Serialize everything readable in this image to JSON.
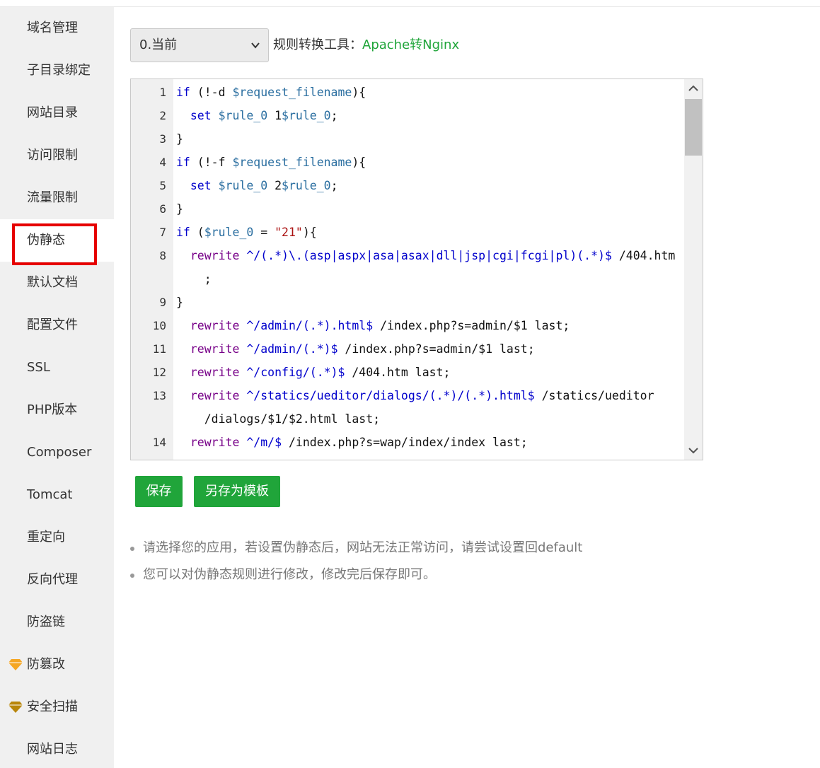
{
  "sidebar": {
    "items": [
      {
        "label": "域名管理",
        "gem": false,
        "active": false
      },
      {
        "label": "子目录绑定",
        "gem": false,
        "active": false
      },
      {
        "label": "网站目录",
        "gem": false,
        "active": false
      },
      {
        "label": "访问限制",
        "gem": false,
        "active": false
      },
      {
        "label": "流量限制",
        "gem": false,
        "active": false
      },
      {
        "label": "伪静态",
        "gem": false,
        "active": true
      },
      {
        "label": "默认文档",
        "gem": false,
        "active": false
      },
      {
        "label": "配置文件",
        "gem": false,
        "active": false
      },
      {
        "label": "SSL",
        "gem": false,
        "active": false
      },
      {
        "label": "PHP版本",
        "gem": false,
        "active": false
      },
      {
        "label": "Composer",
        "gem": false,
        "active": false
      },
      {
        "label": "Tomcat",
        "gem": false,
        "active": false
      },
      {
        "label": "重定向",
        "gem": false,
        "active": false
      },
      {
        "label": "反向代理",
        "gem": false,
        "active": false
      },
      {
        "label": "防盗链",
        "gem": false,
        "active": false
      },
      {
        "label": "防篡改",
        "gem": true,
        "gem_color": "#f5a623",
        "active": false
      },
      {
        "label": "安全扫描",
        "gem": true,
        "gem_color": "#b8860b",
        "active": false
      },
      {
        "label": "网站日志",
        "gem": false,
        "active": false
      }
    ],
    "highlight_color": "#e60000"
  },
  "toolbar": {
    "select_value": "0.当前",
    "tool_label": "规则转换工具：",
    "tool_link": "Apache转Nginx"
  },
  "editor": {
    "lines": [
      {
        "num": "1",
        "tokens": [
          [
            "kw",
            "if"
          ],
          [
            "punct",
            " (!-d "
          ],
          [
            "var",
            "$request_filename"
          ],
          [
            "punct",
            "){"
          ]
        ]
      },
      {
        "num": "2",
        "tokens": [
          [
            "punct",
            "  "
          ],
          [
            "kw",
            "set"
          ],
          [
            "punct",
            " "
          ],
          [
            "var",
            "$rule_0"
          ],
          [
            "punct",
            " 1"
          ],
          [
            "var",
            "$rule_0"
          ],
          [
            "punct",
            ";"
          ]
        ]
      },
      {
        "num": "3",
        "tokens": [
          [
            "punct",
            "}"
          ]
        ]
      },
      {
        "num": "4",
        "tokens": [
          [
            "kw",
            "if"
          ],
          [
            "punct",
            " (!-f "
          ],
          [
            "var",
            "$request_filename"
          ],
          [
            "punct",
            "){"
          ]
        ]
      },
      {
        "num": "5",
        "tokens": [
          [
            "punct",
            "  "
          ],
          [
            "kw",
            "set"
          ],
          [
            "punct",
            " "
          ],
          [
            "var",
            "$rule_0"
          ],
          [
            "punct",
            " 2"
          ],
          [
            "var",
            "$rule_0"
          ],
          [
            "punct",
            ";"
          ]
        ]
      },
      {
        "num": "6",
        "tokens": [
          [
            "punct",
            "}"
          ]
        ]
      },
      {
        "num": "7",
        "tokens": [
          [
            "kw",
            "if"
          ],
          [
            "punct",
            " ("
          ],
          [
            "var",
            "$rule_0"
          ],
          [
            "punct",
            " = "
          ],
          [
            "str",
            "\"21\""
          ],
          [
            "punct",
            "){"
          ]
        ]
      },
      {
        "num": "8",
        "tokens": [
          [
            "punct",
            "  "
          ],
          [
            "fn",
            "rewrite"
          ],
          [
            "punct",
            " "
          ],
          [
            "rx",
            "^/(.*)\\.(asp|aspx|asa|asax|dll|jsp|cgi|fcgi|pl)(.*)$"
          ],
          [
            "punct",
            " /404.htm"
          ]
        ]
      },
      {
        "num": "",
        "tokens": [
          [
            "punct",
            "    ;"
          ]
        ]
      },
      {
        "num": "9",
        "tokens": [
          [
            "punct",
            "}"
          ]
        ]
      },
      {
        "num": "10",
        "tokens": [
          [
            "punct",
            "  "
          ],
          [
            "fn",
            "rewrite"
          ],
          [
            "punct",
            " "
          ],
          [
            "rx",
            "^/admin/(.*).html$"
          ],
          [
            "punct",
            " /index.php?s=admin/$1 last;"
          ]
        ]
      },
      {
        "num": "11",
        "tokens": [
          [
            "punct",
            "  "
          ],
          [
            "fn",
            "rewrite"
          ],
          [
            "punct",
            " "
          ],
          [
            "rx",
            "^/admin/(.*)$"
          ],
          [
            "punct",
            " /index.php?s=admin/$1 last;"
          ]
        ]
      },
      {
        "num": "12",
        "tokens": [
          [
            "punct",
            "  "
          ],
          [
            "fn",
            "rewrite"
          ],
          [
            "punct",
            " "
          ],
          [
            "rx",
            "^/config/(.*)$"
          ],
          [
            "punct",
            " /404.htm last;"
          ]
        ]
      },
      {
        "num": "13",
        "tokens": [
          [
            "punct",
            "  "
          ],
          [
            "fn",
            "rewrite"
          ],
          [
            "punct",
            " "
          ],
          [
            "rx",
            "^/statics/ueditor/dialogs/(.*)/(.*).html$"
          ],
          [
            "punct",
            " /statics/ueditor"
          ]
        ]
      },
      {
        "num": "",
        "tokens": [
          [
            "punct",
            "    /dialogs/$1/$2.html last;"
          ]
        ]
      },
      {
        "num": "14",
        "tokens": [
          [
            "punct",
            "  "
          ],
          [
            "fn",
            "rewrite"
          ],
          [
            "punct",
            " "
          ],
          [
            "rx",
            "^/m/$"
          ],
          [
            "punct",
            " /index.php?s=wap/index/index last;"
          ]
        ]
      }
    ],
    "scroll_fraction": 0.0
  },
  "buttons": {
    "save": "保存",
    "save_template": "另存为模板"
  },
  "tips": [
    "请选择您的应用，若设置伪静态后，网站无法正常访问，请尝试设置回default",
    "您可以对伪静态规则进行修改，修改完后保存即可。"
  ],
  "colors": {
    "accent": "#20a53a",
    "sidebar_bg": "#f0f0f0",
    "gutter_bg": "#f0f0f0"
  }
}
